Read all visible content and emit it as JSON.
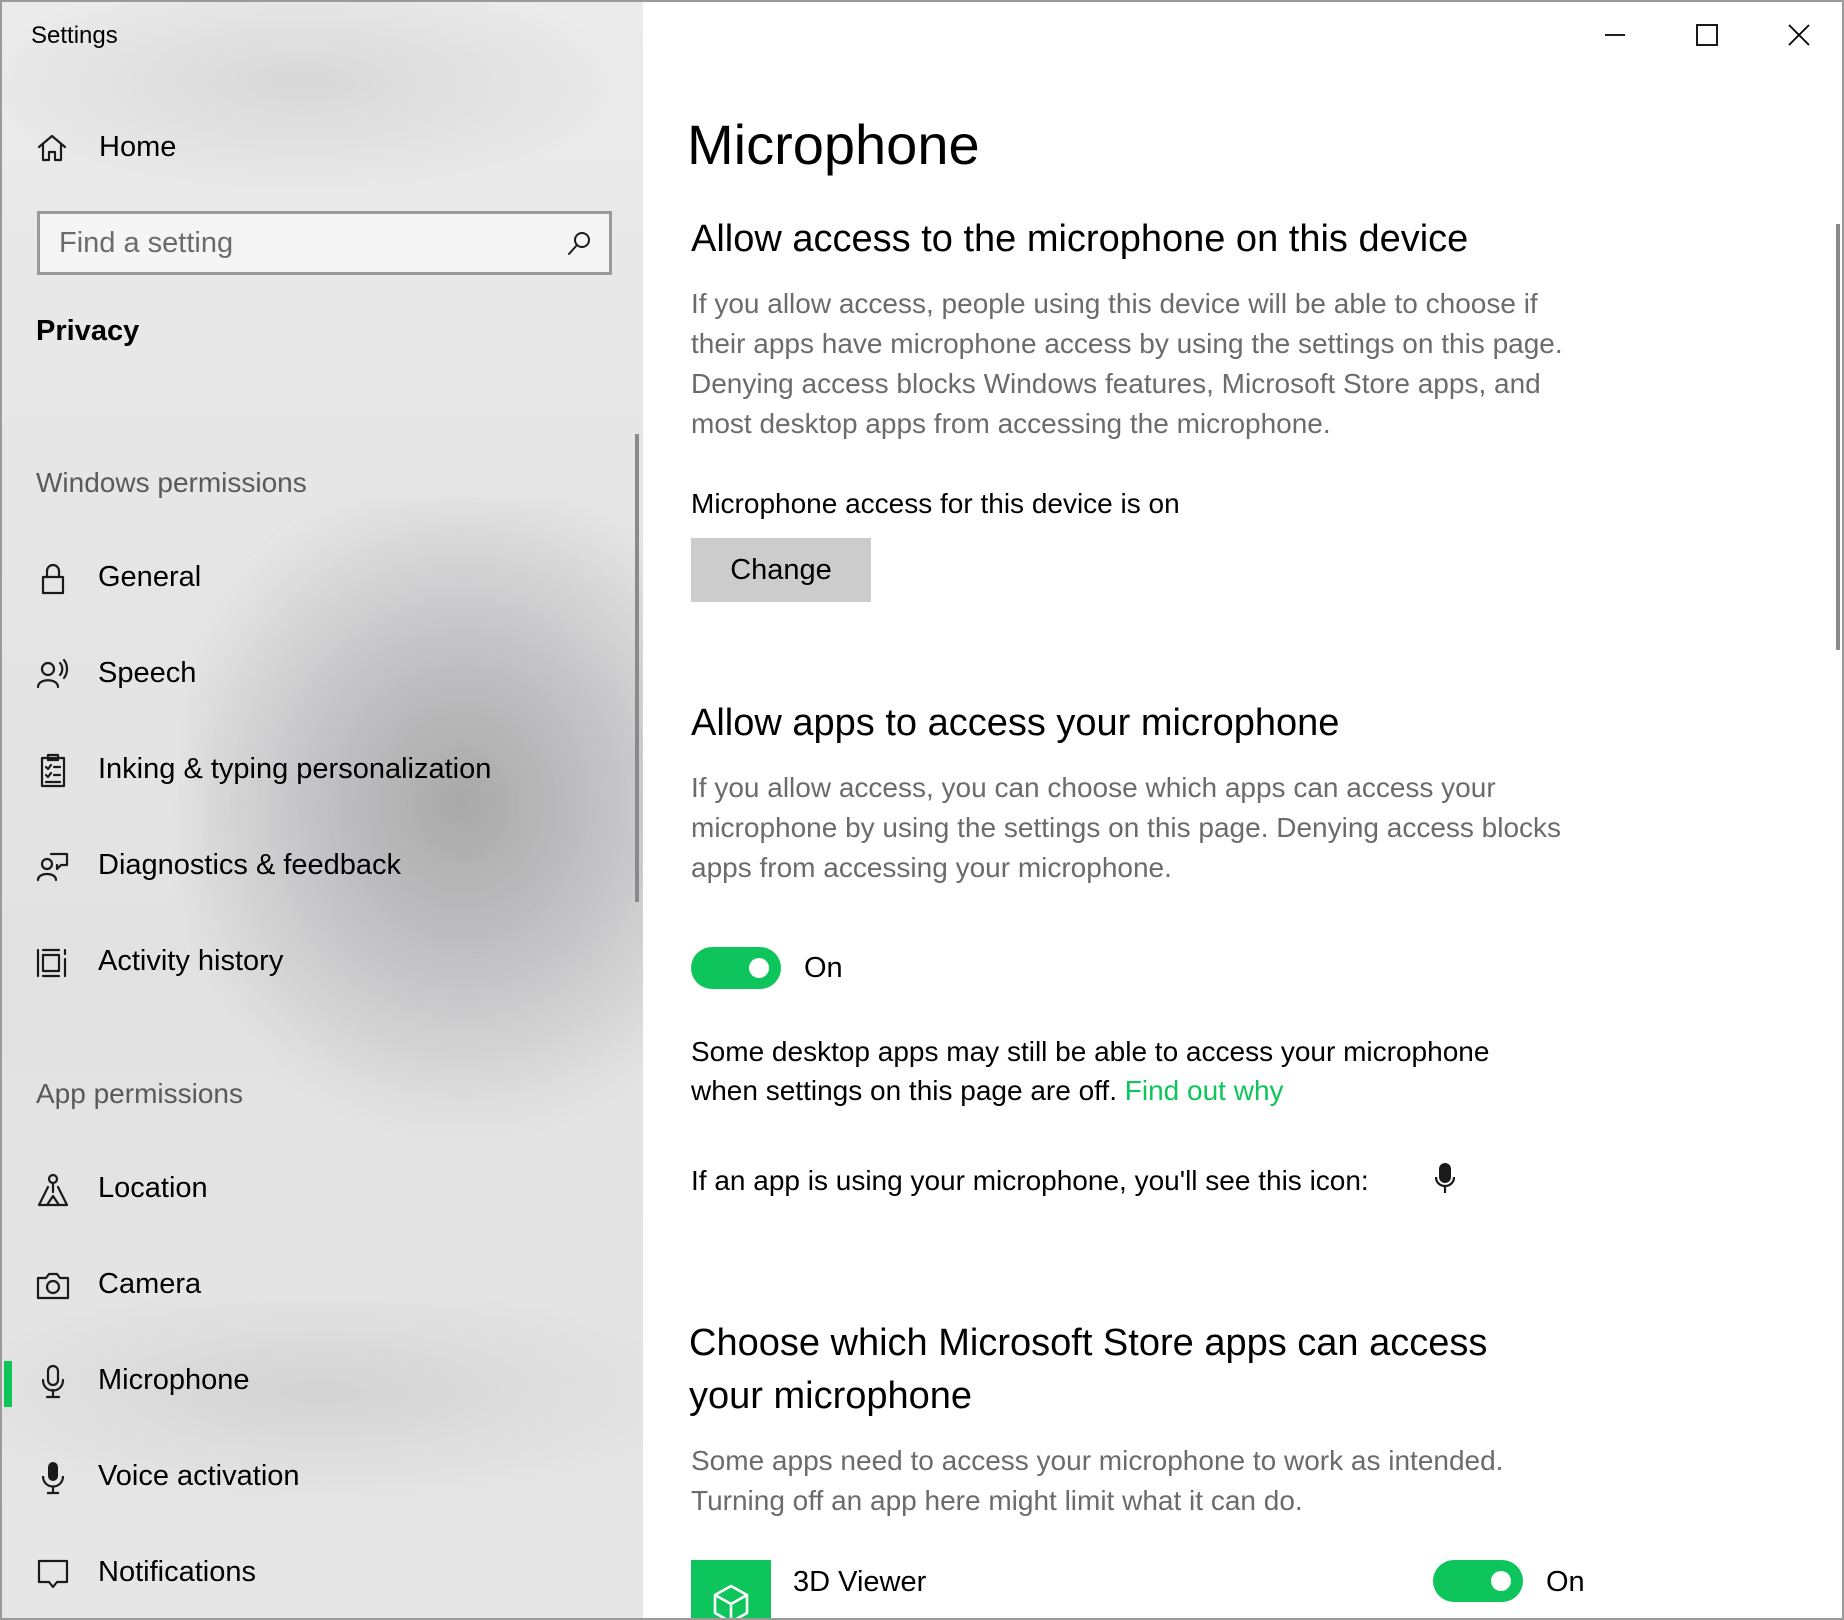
{
  "window": {
    "app_title": "Settings"
  },
  "sidebar": {
    "home_label": "Home",
    "search_placeholder": "Find a setting",
    "section_title": "Privacy",
    "groups": [
      {
        "header": "Windows permissions",
        "items": [
          {
            "label": "General",
            "icon": "lock-icon"
          },
          {
            "label": "Speech",
            "icon": "speech-icon"
          },
          {
            "label": "Inking & typing personalization",
            "icon": "inking-icon"
          },
          {
            "label": "Diagnostics & feedback",
            "icon": "feedback-icon"
          },
          {
            "label": "Activity history",
            "icon": "activity-history-icon"
          }
        ]
      },
      {
        "header": "App permissions",
        "items": [
          {
            "label": "Location",
            "icon": "location-icon"
          },
          {
            "label": "Camera",
            "icon": "camera-icon"
          },
          {
            "label": "Microphone",
            "icon": "microphone-icon",
            "active": true
          },
          {
            "label": "Voice activation",
            "icon": "voice-activation-icon"
          },
          {
            "label": "Notifications",
            "icon": "notifications-icon"
          }
        ]
      }
    ]
  },
  "main": {
    "page_title": "Microphone",
    "device_section": {
      "title": "Allow access to the microphone on this device",
      "description": "If you allow access, people using this device will be able to choose if their apps have microphone access by using the settings on this page. Denying access blocks Windows features, Microsoft Store apps, and most desktop apps from accessing the microphone.",
      "status": "Microphone access for this device is on",
      "change_button": "Change"
    },
    "apps_section": {
      "title": "Allow apps to access your microphone",
      "description": "If you allow access, you can choose which apps can access your microphone by using the settings on this page. Denying access blocks apps from accessing your microphone.",
      "toggle_state": "On",
      "desktop_note_line1": "Some desktop apps may still be able to access your microphone",
      "desktop_note_line2": "when settings on this page are off.",
      "find_out_why_link": "Find out why",
      "icon_note": "If an app is using your microphone, you'll see this icon:"
    },
    "store_section": {
      "title_line1": "Choose which Microsoft Store apps can access",
      "title_line2": "your microphone",
      "description": "Some apps need to access your microphone to work as intended. Turning off an app here might limit what it can do.",
      "apps": [
        {
          "name": "3D Viewer",
          "toggle_state": "On",
          "icon": "3d-viewer-icon"
        }
      ]
    }
  },
  "colors": {
    "accent": "#0dc55a",
    "button_bg": "#cccccc",
    "description_text": "#6b6b6b"
  }
}
